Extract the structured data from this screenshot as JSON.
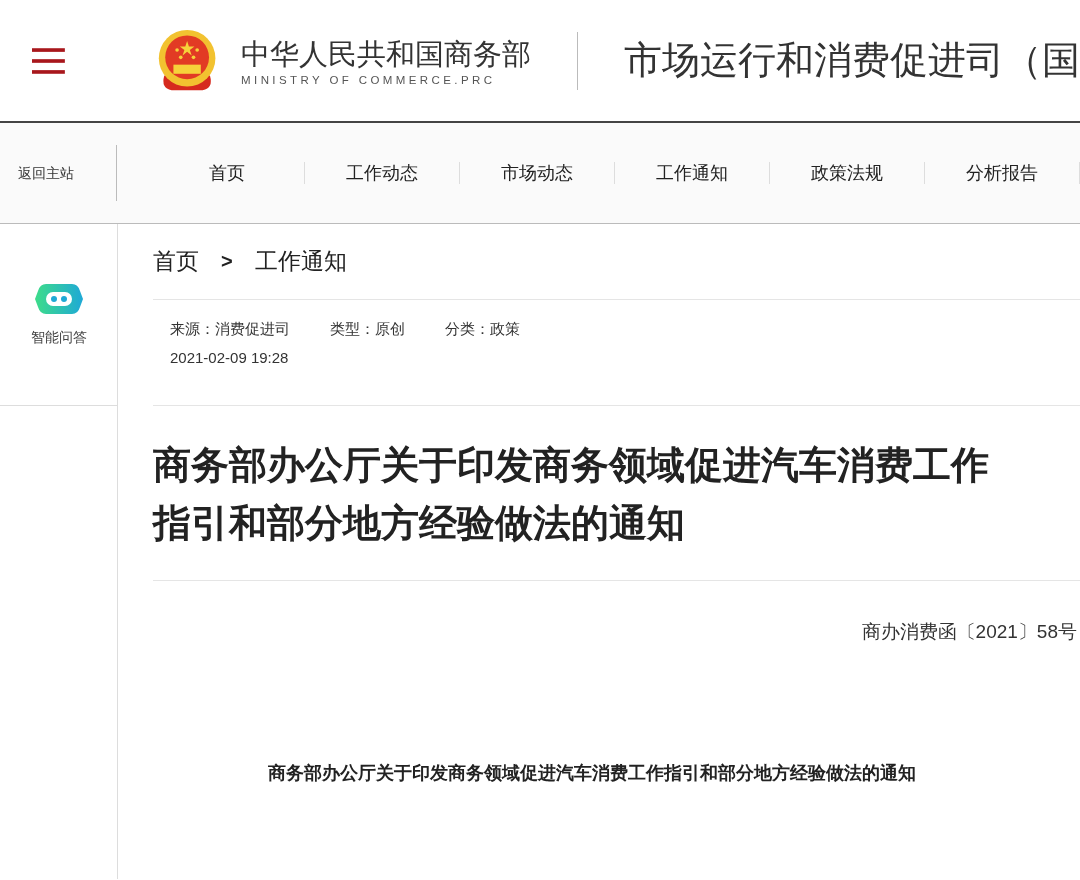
{
  "header": {
    "site_name": "中华人民共和国商务部",
    "site_name_en": "MINISTRY OF COMMERCE.PRC",
    "section_title": "市场运行和消费促进司（国"
  },
  "nav": {
    "back_link": "返回主站",
    "items": [
      {
        "label": "首页",
        "selected": false
      },
      {
        "label": "工作动态",
        "selected": false
      },
      {
        "label": "市场动态",
        "selected": false
      },
      {
        "label": "工作通知",
        "selected": false
      },
      {
        "label": "政策法规",
        "selected": false
      },
      {
        "label": "分析报告",
        "selected": false
      }
    ]
  },
  "sidebar": {
    "assistant_label": "智能问答"
  },
  "breadcrumb": {
    "separator": ">",
    "items": [
      "首页",
      "工作通知"
    ]
  },
  "meta": {
    "source_label": "来源：",
    "source": "消费促进司",
    "type_label": "类型：",
    "type": "原创",
    "category_label": "分类：",
    "category": "政策",
    "date": "2021-02-09 19:28"
  },
  "article": {
    "title_lines": [
      "商务部办公厅关于印发商务领域促进汽车消费工作",
      "指引和部分地方经验做法的通知"
    ],
    "doc_number": "商办消费函〔2021〕58号",
    "subtitle": "商务部办公厅关于印发商务领域促进汽车消费工作指引和部分地方经验做法的通知"
  }
}
